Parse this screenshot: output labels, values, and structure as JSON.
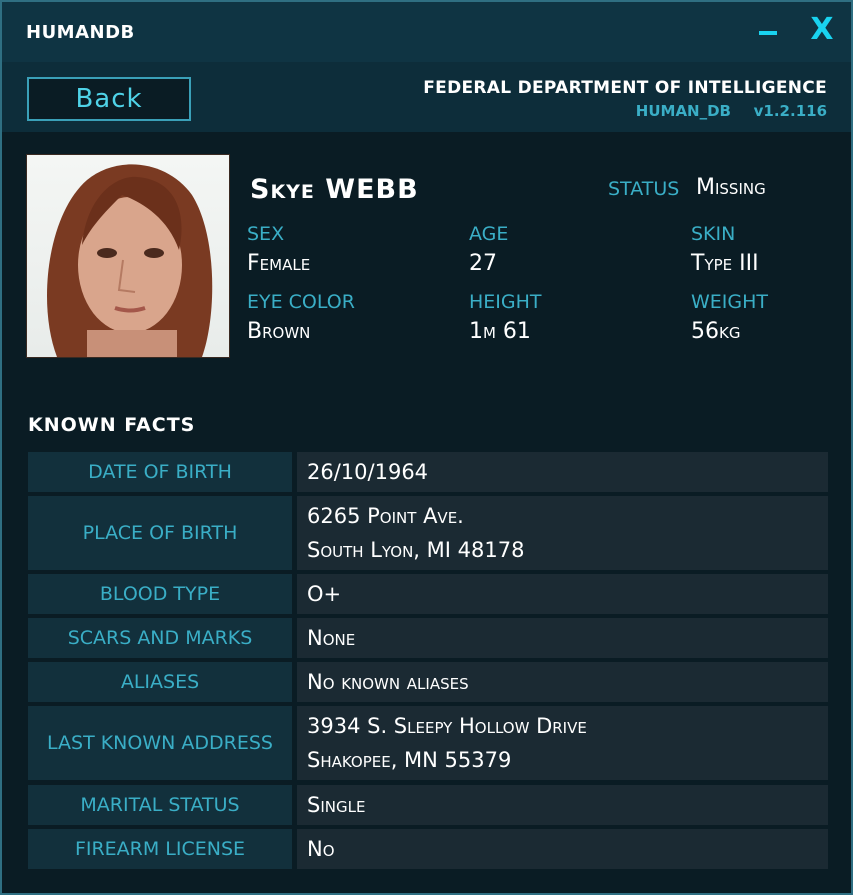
{
  "window": {
    "title": "HUMANDB",
    "minimize": "–",
    "close": "X"
  },
  "header": {
    "back_label": "Back",
    "org": "FEDERAL DEPARTMENT OF INTELLIGENCE",
    "db_name": "HUMAN_DB",
    "version": "v1.2.116"
  },
  "profile": {
    "name": "Skye  WEBB",
    "status_label": "STATUS",
    "status": "Missing",
    "sex_label": "SEX",
    "sex": "Female",
    "age_label": "AGE",
    "age": "27",
    "skin_label": "SKIN",
    "skin": "Type III",
    "eye_label": "EYE COLOR",
    "eye": "Brown",
    "height_label": "HEIGHT",
    "height": "1m 61",
    "weight_label": "WEIGHT",
    "weight": "56kg"
  },
  "facts_title": "KNOWN  FACTS",
  "facts": [
    {
      "key": "DATE OF BIRTH",
      "lines": [
        "26/10/1964"
      ]
    },
    {
      "key": "PLACE OF BIRTH",
      "lines": [
        "6265 Point Ave.",
        "South Lyon, MI 48178"
      ]
    },
    {
      "key": "BLOOD TYPE",
      "lines": [
        "O+"
      ]
    },
    {
      "key": "SCARS AND MARKS",
      "lines": [
        "None"
      ]
    },
    {
      "key": "ALIASES",
      "lines": [
        "No known aliases"
      ]
    },
    {
      "key": "LAST KNOWN ADDRESS",
      "lines": [
        "3934 S. Sleepy Hollow Drive",
        "Shakopee, MN 55379"
      ]
    },
    {
      "key": "MARITAL STATUS",
      "lines": [
        "Single"
      ]
    },
    {
      "key": "FIREARM LICENSE",
      "lines": [
        "No"
      ]
    }
  ],
  "colors": {
    "accent": "#19d3f0",
    "label": "#3aaec6",
    "background": "#0a1c24"
  }
}
